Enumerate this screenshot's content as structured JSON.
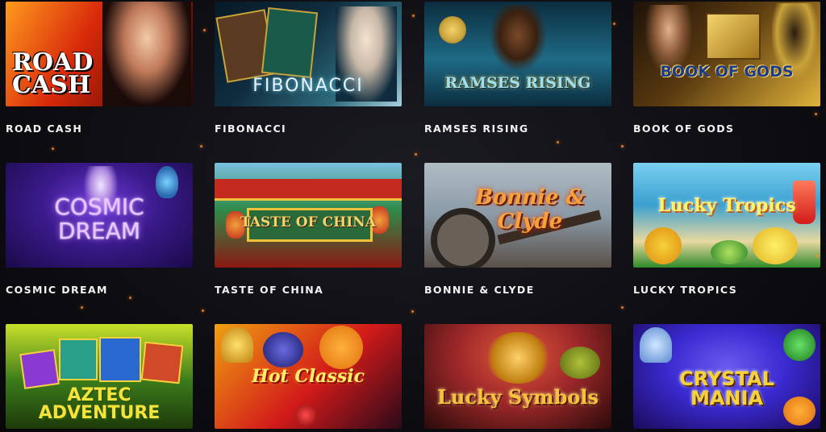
{
  "games": [
    {
      "name": "ROAD CASH",
      "art_title": "ROAD CASH",
      "colors": [
        "#d92a0b",
        "#ff8a1c",
        "#3a0a04"
      ]
    },
    {
      "name": "FIBONACCI",
      "art_title": "FIBONACCI",
      "colors": [
        "#0f2c3e",
        "#2e6c7c",
        "#cfe6ee"
      ]
    },
    {
      "name": "RAMSES RISING",
      "art_title": "RAMSES RISING",
      "colors": [
        "#1f6a86",
        "#c9a23a",
        "#0b2d3e"
      ]
    },
    {
      "name": "BOOK OF GODS",
      "art_title": "BOOK OF GODS",
      "colors": [
        "#5a3a10",
        "#e0b23a",
        "#1d1208"
      ]
    },
    {
      "name": "COSMIC DREAM",
      "art_title": "COSMIC DREAM",
      "colors": [
        "#1a0a4a",
        "#6c3ad8",
        "#c07cff"
      ]
    },
    {
      "name": "TASTE OF CHINA",
      "art_title": "TASTE OF CHINA",
      "colors": [
        "#2f8a4a",
        "#c42a1e",
        "#f2c23a"
      ]
    },
    {
      "name": "BONNIE & CLYDE",
      "art_title": "Bonnie & Clyde",
      "colors": [
        "#8a9aa6",
        "#e6451a",
        "#3a2b22"
      ]
    },
    {
      "name": "LUCKY TROPICS",
      "art_title": "Lucky Tropics",
      "colors": [
        "#3aa0d0",
        "#f5d23a",
        "#2e8a2a"
      ]
    },
    {
      "name": "AZTEC ADVENTURE",
      "art_title": "AZTEC ADVENTURE",
      "colors": [
        "#3a7a1a",
        "#c8e02a",
        "#1d3a0a"
      ]
    },
    {
      "name": "HOT CLASSIC",
      "art_title": "Hot Classic",
      "colors": [
        "#f0a010",
        "#d21a1a",
        "#2a0a1a"
      ]
    },
    {
      "name": "LUCKY SYMBOLS",
      "art_title": "Lucky Symbols",
      "colors": [
        "#a0282a",
        "#e09a2a",
        "#2a0a0a"
      ]
    },
    {
      "name": "CRYSTAL MANIA",
      "art_title": "CRYSTAL MANIA",
      "colors": [
        "#3a2ad0",
        "#f0c030",
        "#1a0a5a"
      ]
    }
  ]
}
